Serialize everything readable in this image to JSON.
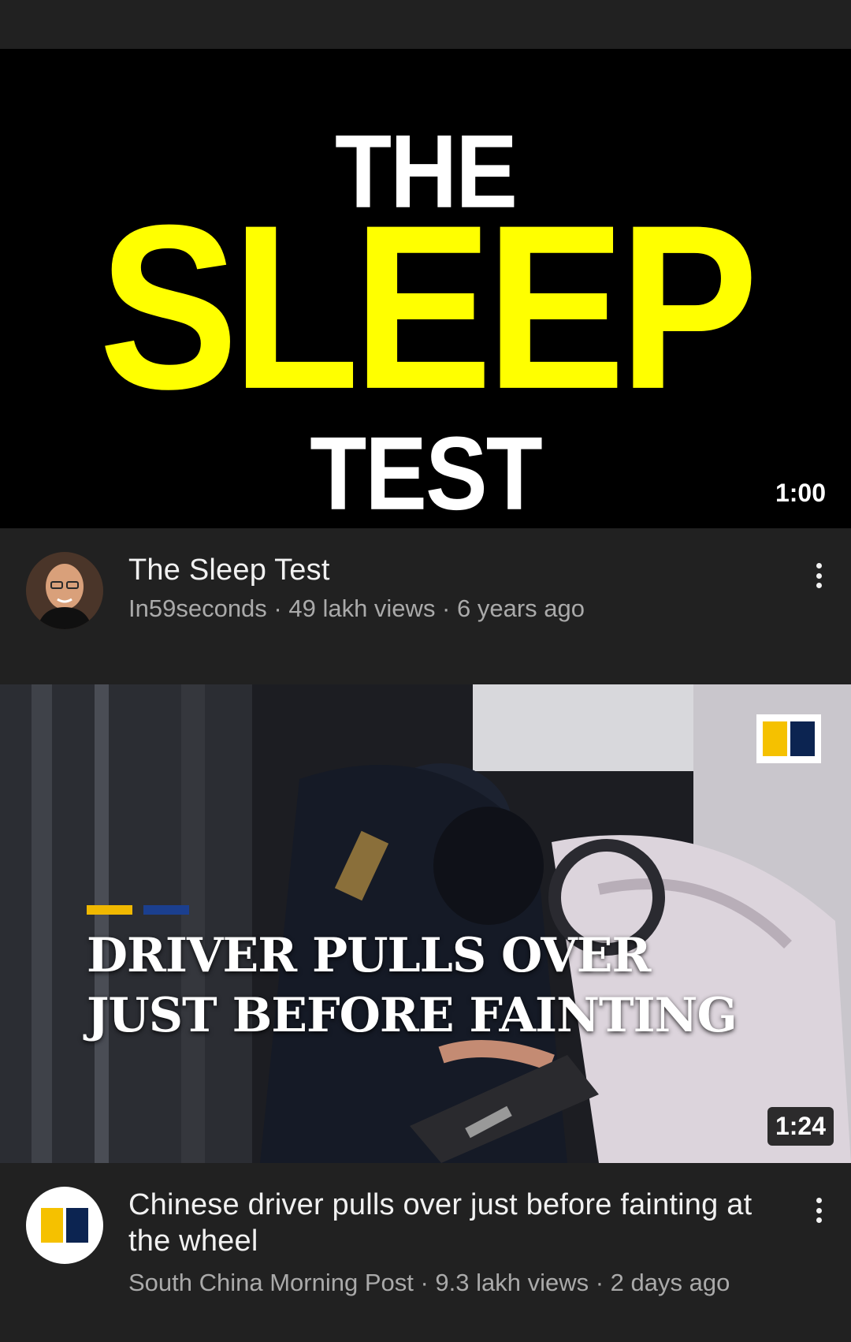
{
  "video1": {
    "thumbnail": {
      "line1": "THE",
      "line2": "SLEEP",
      "line3": "TEST",
      "colors": {
        "background": "#000000",
        "accent": "#ffff00",
        "text": "#ffffff"
      }
    },
    "duration": "1:00",
    "title": "The Sleep Test",
    "subtitle": "In59seconds · 49 lakh views · 6 years ago",
    "channel_avatar": "avatar-photo",
    "menu_icon": "more-vert-icon"
  },
  "video2": {
    "thumbnail": {
      "caption_line1": "DRIVER PULLS OVER",
      "caption_line2": "JUST BEFORE FAINTING",
      "logo_icon": "scmp-logo-icon",
      "colors": {
        "yellow": "#f5c100",
        "navy": "#0c2451"
      }
    },
    "duration": "1:24",
    "title": "Chinese driver pulls over just before fainting at the wheel",
    "subtitle": "South China Morning Post · 9.3 lakh views · 2 days ago",
    "channel_avatar": "scmp-logo-icon",
    "menu_icon": "more-vert-icon"
  },
  "theme": {
    "background": "#212121",
    "primary_text": "#f1f1f1",
    "secondary_text": "#aaaaaa"
  }
}
